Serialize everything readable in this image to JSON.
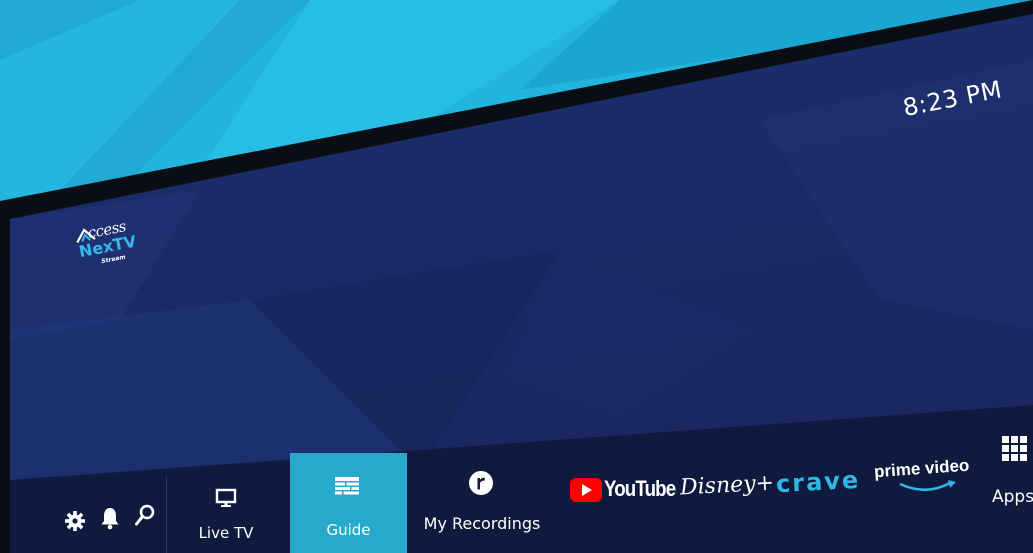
{
  "clock": {
    "time": "8:23 PM"
  },
  "logo": {
    "line1": "ccess",
    "line2": "NexTV",
    "line3": "Stream"
  },
  "nav": {
    "utility_icons": [
      "gear-icon",
      "bell-icon",
      "search-icon"
    ],
    "items": [
      {
        "label": "Live TV",
        "icon": "tv-monitor-icon",
        "selected": false
      },
      {
        "label": "Guide",
        "icon": "guide-grid-icon",
        "selected": true
      },
      {
        "label": "My Recordings",
        "icon": "recordings-r-icon",
        "selected": false
      }
    ],
    "apps": [
      {
        "label": "YouTube",
        "icon": "youtube-play-icon"
      },
      {
        "label": "Disney+"
      },
      {
        "label": "crave"
      },
      {
        "label": "prime video"
      }
    ],
    "apps_button": {
      "label": "Apps",
      "icon": "apps-grid-icon"
    }
  },
  "colors": {
    "sky": "#22b5dc",
    "screen": "#1d2f6e",
    "nav_bar": "#0f1b3e",
    "selected": "#27a9cc",
    "crave": "#2fb8e6",
    "youtube_red": "#ff0000",
    "prime_blue": "#2fb8e6"
  }
}
